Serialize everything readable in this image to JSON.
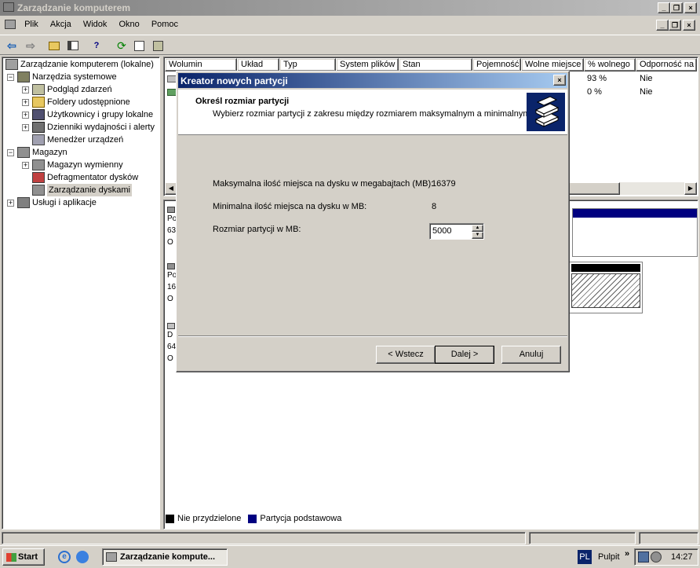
{
  "window": {
    "title": "Zarządzanie komputerem"
  },
  "menu": [
    "Plik",
    "Akcja",
    "Widok",
    "Okno",
    "Pomoc"
  ],
  "tree": {
    "root": "Zarządzanie komputerem (lokalne)",
    "system_tools": "Narzędzia systemowe",
    "event_viewer": "Podgląd zdarzeń",
    "shared_folders": "Foldery udostępnione",
    "users_groups": "Użytkownicy i grupy lokalne",
    "perf_logs": "Dzienniki wydajności i alerty",
    "device_manager": "Menedżer urządzeń",
    "storage": "Magazyn",
    "removable_storage": "Magazyn wymienny",
    "defragmenter": "Defragmentator dysków",
    "disk_management": "Zarządzanie dyskami",
    "services_apps": "Usługi i aplikacje"
  },
  "volume_table": {
    "columns": [
      "Wolumin",
      "Układ",
      "Typ",
      "System plików",
      "Stan",
      "Pojemność",
      "Wolne miejsce",
      "% wolnego",
      "Odporność na u"
    ],
    "rows": [
      {
        "pct_free": "93 %",
        "fault_tolerance": "Nie"
      },
      {
        "pct_free": "0 %",
        "fault_tolerance": "Nie"
      }
    ]
  },
  "disk_panel": {
    "disk0": [
      "Po",
      "63",
      "O"
    ],
    "disk1": [
      "Po",
      "16",
      "O"
    ],
    "cdrom": [
      "D",
      "64",
      "O"
    ]
  },
  "legend": {
    "unallocated": "Nie przydzielone",
    "primary": "Partycja podstawowa"
  },
  "dialog": {
    "title": "Kreator nowych partycji",
    "header_title": "Określ rozmiar partycji",
    "header_subtitle": "Wybierz rozmiar partycji z zakresu między rozmiarem maksymalnym a minimalnym.",
    "max_label": "Maksymalna ilość miejsca na dysku w megabajtach (MB):",
    "max_value": "16379",
    "min_label": "Minimalna ilość miejsca na dysku w MB:",
    "min_value": "8",
    "size_label": "Rozmiar partycji w MB:",
    "size_value": "5000",
    "back_button": "< Wstecz",
    "next_button": "Dalej >",
    "cancel_button": "Anuluj"
  },
  "taskbar": {
    "start": "Start",
    "task_button": "Zarządzanie kompute...",
    "lang": "PL",
    "desktop": "Pulpit",
    "time": "14:27"
  },
  "colors": {
    "titlebar": "#0a246a",
    "face": "#d4d0c8",
    "primary_partition": "#000080"
  }
}
